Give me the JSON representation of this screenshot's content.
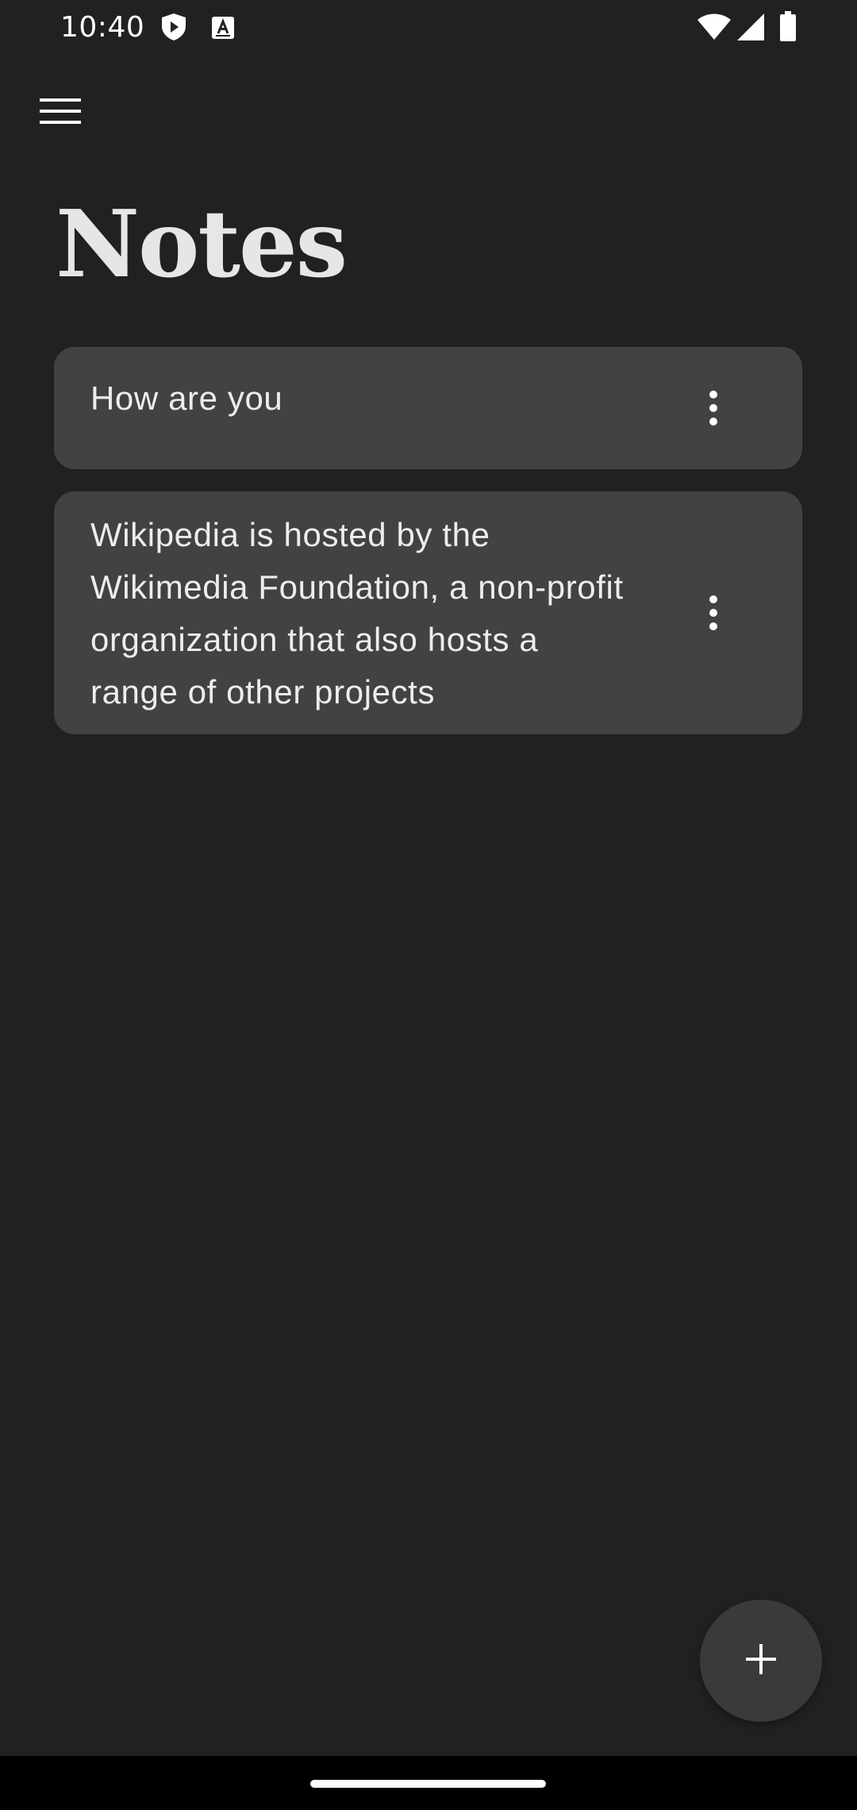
{
  "status_bar": {
    "time": "10:40",
    "left_icons": [
      "shield-icon",
      "keyboard-a-icon"
    ],
    "right_icons": [
      "wifi-icon",
      "cellular-signal-icon",
      "battery-icon"
    ]
  },
  "toolbar": {
    "menu_icon": "hamburger-menu-icon"
  },
  "page": {
    "title": "Notes"
  },
  "notes": [
    {
      "text": "How are you",
      "menu_icon": "more-vert-icon"
    },
    {
      "text": "Wikipedia is hosted by the Wikimedia Foundation, a non-profit organization that also hosts a range of other projects",
      "menu_icon": "more-vert-icon"
    }
  ],
  "fab": {
    "icon": "plus-icon"
  },
  "colors": {
    "background": "#212121",
    "card": "#424242",
    "fab": "#3a3a3a",
    "text": "#ededed"
  }
}
